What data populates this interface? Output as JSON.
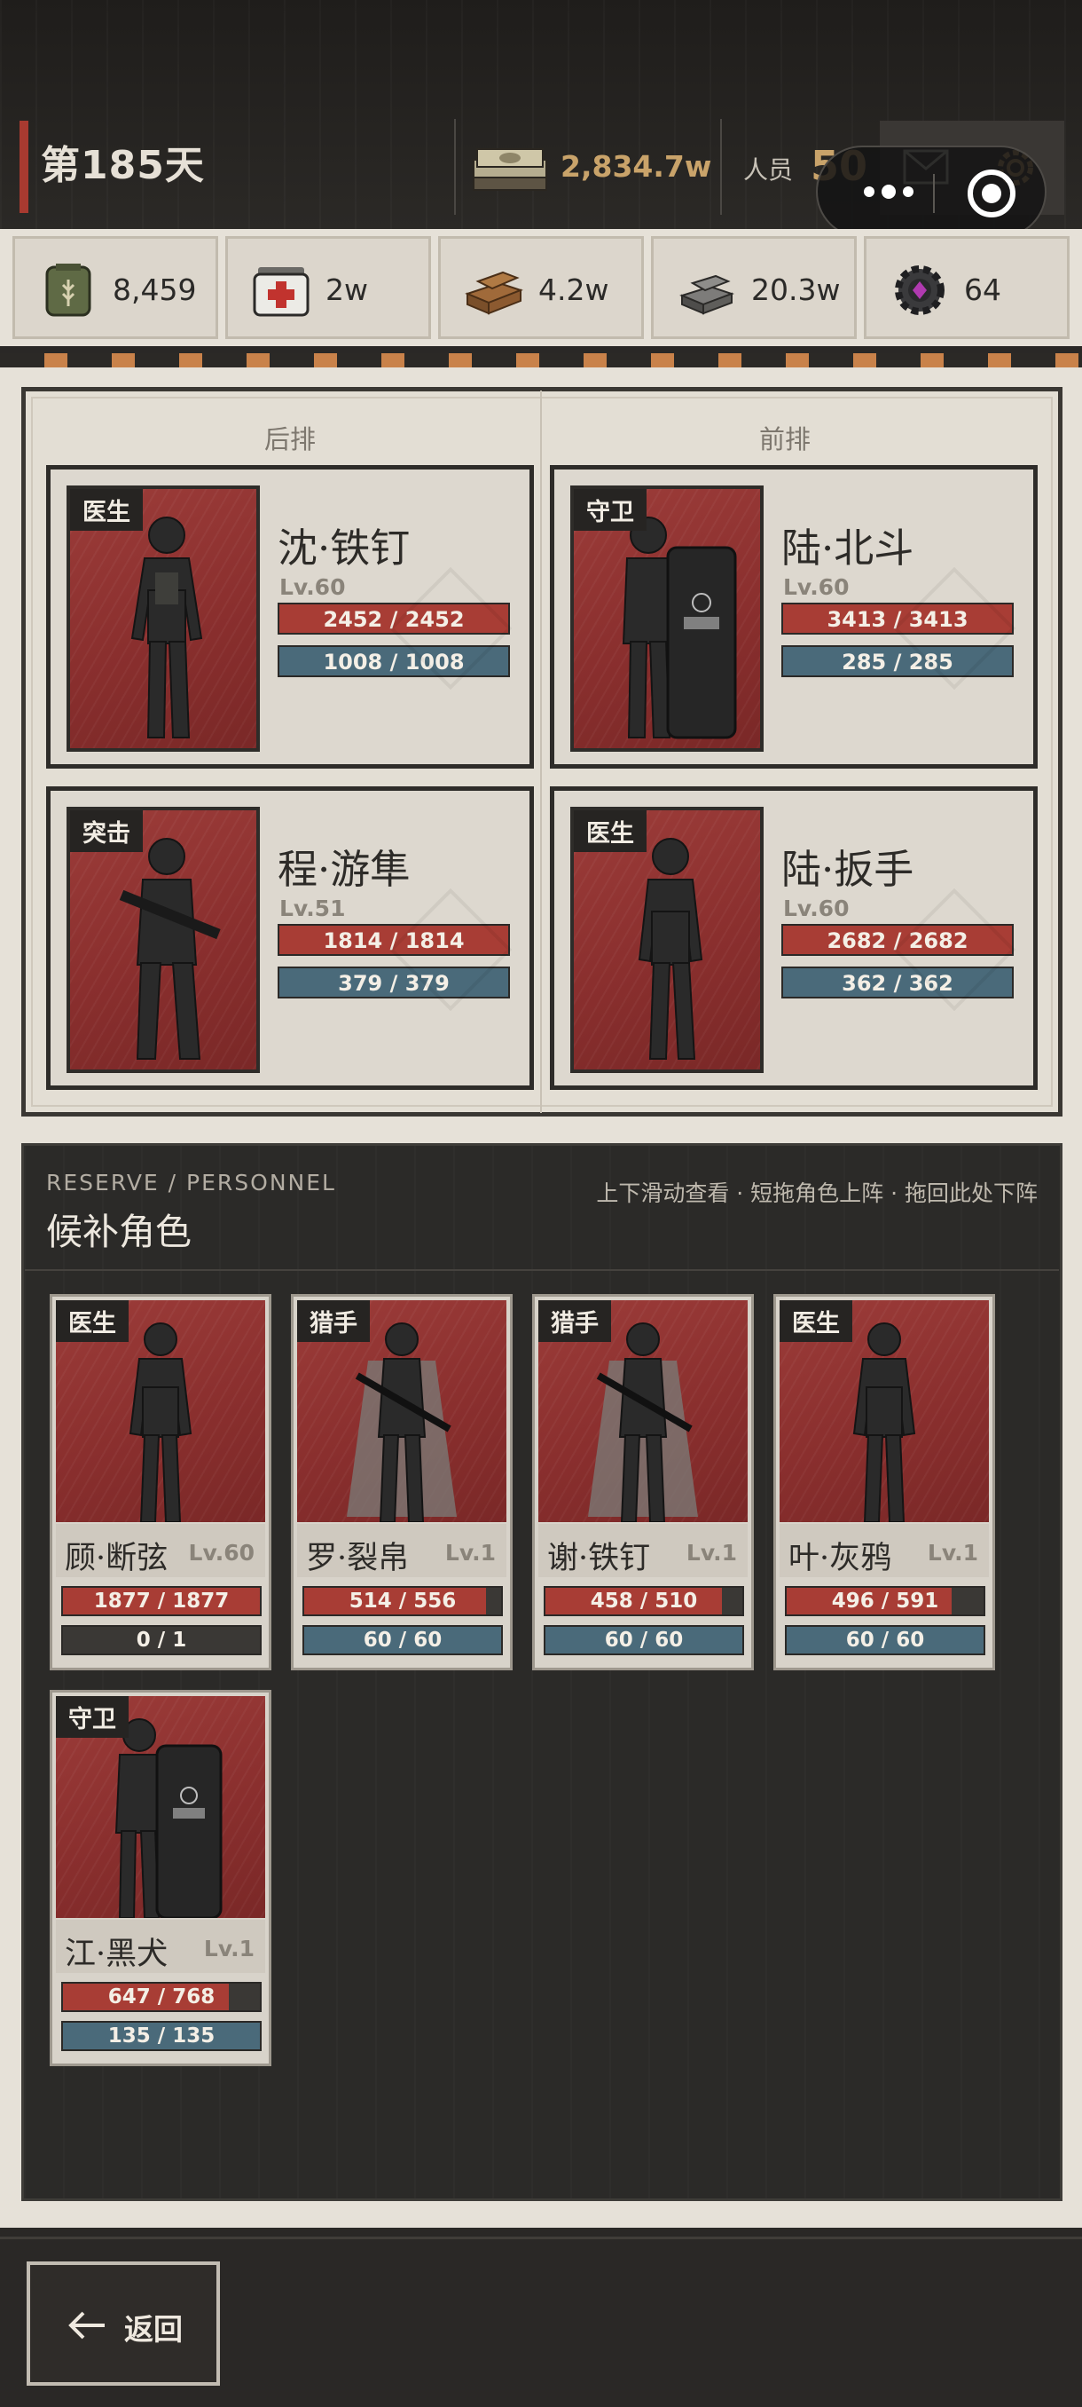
{
  "header": {
    "day": "第185天",
    "cash": "2,834.7w",
    "personnel_label": "人员",
    "personnel_value": "50"
  },
  "resources": [
    {
      "icon": "grain-sack-icon",
      "value": "8,459"
    },
    {
      "icon": "medkit-icon",
      "value": "2w"
    },
    {
      "icon": "wood-planks-icon",
      "value": "4.2w"
    },
    {
      "icon": "steel-ingots-icon",
      "value": "20.3w"
    },
    {
      "icon": "gear-chip-icon",
      "value": "64"
    }
  ],
  "formation": {
    "back_label": "后排",
    "front_label": "前排",
    "cards": [
      {
        "role": "医生",
        "name": "沈·铁钉",
        "level": "Lv.60",
        "hp": "2452 / 2452",
        "hp_ratio": 1.0,
        "mp": "1008 / 1008",
        "mp_ratio": 1.0
      },
      {
        "role": "守卫",
        "name": "陆·北斗",
        "level": "Lv.60",
        "hp": "3413 / 3413",
        "hp_ratio": 1.0,
        "mp": "285 / 285",
        "mp_ratio": 1.0
      },
      {
        "role": "突击",
        "name": "程·游隼",
        "level": "Lv.51",
        "hp": "1814 / 1814",
        "hp_ratio": 1.0,
        "mp": "379 / 379",
        "mp_ratio": 1.0
      },
      {
        "role": "医生",
        "name": "陆·扳手",
        "level": "Lv.60",
        "hp": "2682 / 2682",
        "hp_ratio": 1.0,
        "mp": "362 / 362",
        "mp_ratio": 1.0
      }
    ]
  },
  "reserve": {
    "subtitle": "RESERVE / PERSONNEL",
    "title": "候补角色",
    "hint": "上下滑动查看 · 短拖角色上阵 · 拖回此处下阵",
    "cards": [
      {
        "role": "医生",
        "name": "顾·断弦",
        "level": "Lv.60",
        "hp": "1877 / 1877",
        "hp_ratio": 1.0,
        "mp": "0 / 1",
        "mp_ratio": 0.0
      },
      {
        "role": "猎手",
        "name": "罗·裂帛",
        "level": "Lv.1",
        "hp": "514 / 556",
        "hp_ratio": 0.924,
        "mp": "60 / 60",
        "mp_ratio": 1.0
      },
      {
        "role": "猎手",
        "name": "谢·铁钉",
        "level": "Lv.1",
        "hp": "458 / 510",
        "hp_ratio": 0.898,
        "mp": "60 / 60",
        "mp_ratio": 1.0
      },
      {
        "role": "医生",
        "name": "叶·灰鸦",
        "level": "Lv.1",
        "hp": "496 / 591",
        "hp_ratio": 0.839,
        "mp": "60 / 60",
        "mp_ratio": 1.0
      },
      {
        "role": "守卫",
        "name": "江·黑犬",
        "level": "Lv.1",
        "hp": "647 / 768",
        "hp_ratio": 0.842,
        "mp": "135 / 135",
        "mp_ratio": 1.0
      }
    ]
  },
  "footer": {
    "back_label": "返回"
  },
  "colors": {
    "accent_gold": "#c9a36a",
    "hp_red": "#a83d35",
    "mp_blue": "#4a6a7a",
    "portrait_red": "#9c3c39"
  }
}
